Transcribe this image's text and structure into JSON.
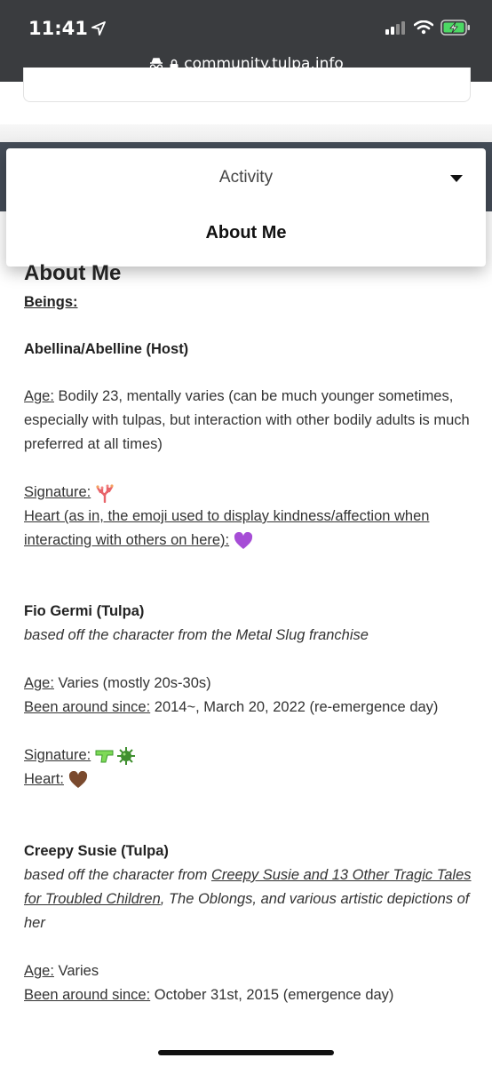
{
  "status": {
    "time": "11:41",
    "url": "community.tulpa.info"
  },
  "menu": {
    "activity": "Activity",
    "about": "About Me"
  },
  "page": {
    "heading": "About Me",
    "beings_label": "Beings:",
    "host": {
      "name": "Abellina/Abelline (Host)",
      "age_label": "Age:",
      "age_value": " Bodily 23, mentally varies (can be much younger sometimes, especially with tulpas, but interaction with other bodily adults is much preferred at all times)",
      "signature_label": "Signature:",
      "heart_label": "Heart (as in, the emoji used to display kindness/affection when interacting with others on here):"
    },
    "fio": {
      "name": "Fio Germi (Tulpa)",
      "desc": "based off the character from the Metal Slug franchise",
      "age_label": "Age:",
      "age_value": " Varies (mostly 20s-30s)",
      "since_label": "Been around since:",
      "since_value": " 2014~, March 20, 2022 (re-emergence day)",
      "signature_label": "Signature:",
      "heart_label": "Heart:"
    },
    "susie": {
      "name": "Creepy Susie (Tulpa)",
      "desc_pre": "based off the character from ",
      "desc_link": "Creepy Susie and 13 Other Tragic Tales for Troubled Children",
      "desc_post": ", The Oblongs, and various artistic depictions of her",
      "age_label": "Age:",
      "age_value": " Varies",
      "since_label": "Been around since:",
      "since_value": " October 31st, 2015 (emergence day)"
    }
  },
  "icons": [
    "location-arrow-icon",
    "signal-icon",
    "wifi-icon",
    "battery-charging-icon",
    "incognito-icon",
    "lock-icon",
    "coral-emoji-icon",
    "purple-heart-emoji-icon",
    "water-pistol-emoji-icon",
    "microbe-emoji-icon",
    "brown-heart-emoji-icon"
  ],
  "colors": {
    "status_bg": "#3a3c3f",
    "nav_band": "#444c57",
    "battery_green": "#4cd964",
    "purple_heart": "#a64dd6",
    "brown_heart": "#7a4a2e"
  }
}
